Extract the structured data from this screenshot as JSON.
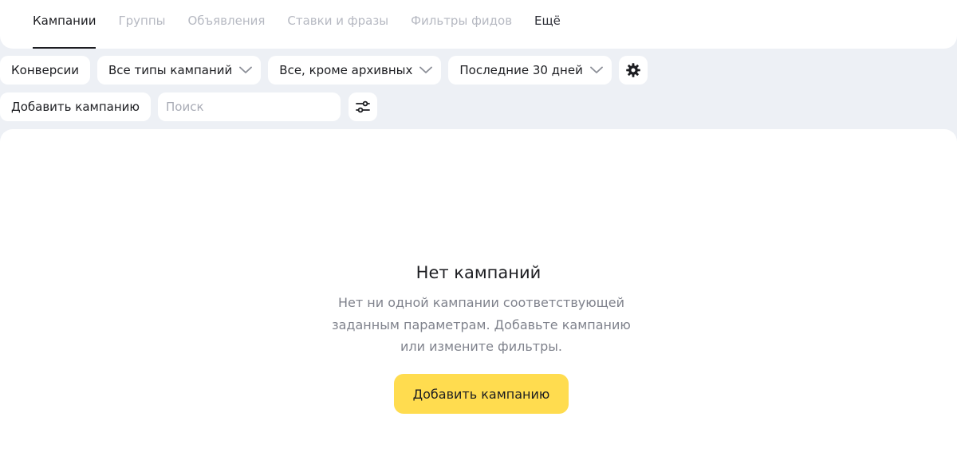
{
  "tabs": [
    {
      "label": "Кампании",
      "active": true
    },
    {
      "label": "Группы",
      "active": false
    },
    {
      "label": "Объявления",
      "active": false
    },
    {
      "label": "Ставки и фразы",
      "active": false
    },
    {
      "label": "Фильтры фидов",
      "active": false
    },
    {
      "label": "Ещё",
      "active": false
    }
  ],
  "filters": {
    "conversions_label": "Конверсии",
    "campaign_type": "Все типы кампаний",
    "status": "Все, кроме архивных",
    "period": "Последние 30 дней",
    "settings_icon": "gear-icon"
  },
  "actions": {
    "add_campaign_label": "Добавить кампанию",
    "search_placeholder": "Поиск",
    "filter_settings_icon": "sliders-icon"
  },
  "empty_state": {
    "title": "Нет кампаний",
    "text": "Нет ни одной кампании соответствующей заданным параметрам. Добавьте кампанию или измените фильтры.",
    "button_label": "Добавить кампанию"
  },
  "colors": {
    "page_background": "#edf0f5",
    "accent_yellow": "#ffdc4f",
    "inactive_tab": "#b6b9c2",
    "muted_text": "#7f828c"
  }
}
